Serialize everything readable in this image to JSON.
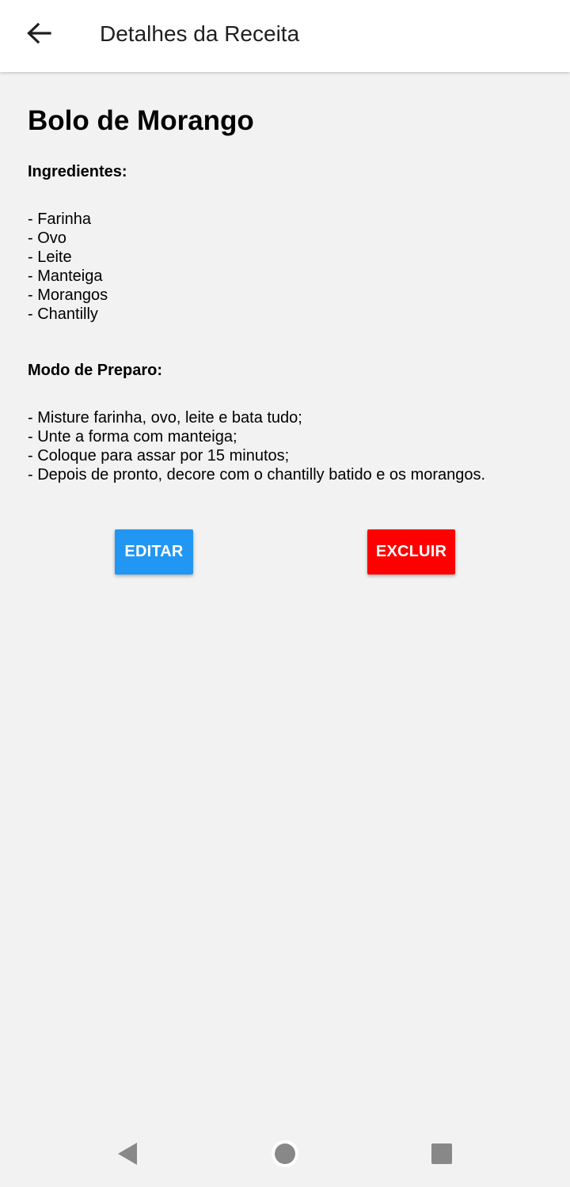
{
  "app_bar": {
    "title": "Detalhes da Receita",
    "back_icon": "arrow-left-icon"
  },
  "recipe": {
    "name": "Bolo de Morango",
    "ingredients_label": "Ingredientes:",
    "ingredients": [
      "- Farinha",
      "- Ovo",
      "- Leite",
      "- Manteiga",
      "- Morangos",
      "- Chantilly"
    ],
    "preparation_label": "Modo de Preparo:",
    "preparation": [
      "- Misture farinha, ovo, leite e bata tudo;",
      "- Unte a forma com manteiga;",
      "- Coloque para assar por 15 minutos;",
      "- Depois de pronto, decore com o chantilly batido e os morangos."
    ]
  },
  "actions": {
    "edit_label": "EDITAR",
    "delete_label": "EXCLUIR",
    "edit_color": "#2196f3",
    "delete_color": "#ff0000"
  },
  "nav_bar": {
    "icons": [
      "nav-back-icon",
      "nav-home-icon",
      "nav-recents-icon"
    ]
  }
}
